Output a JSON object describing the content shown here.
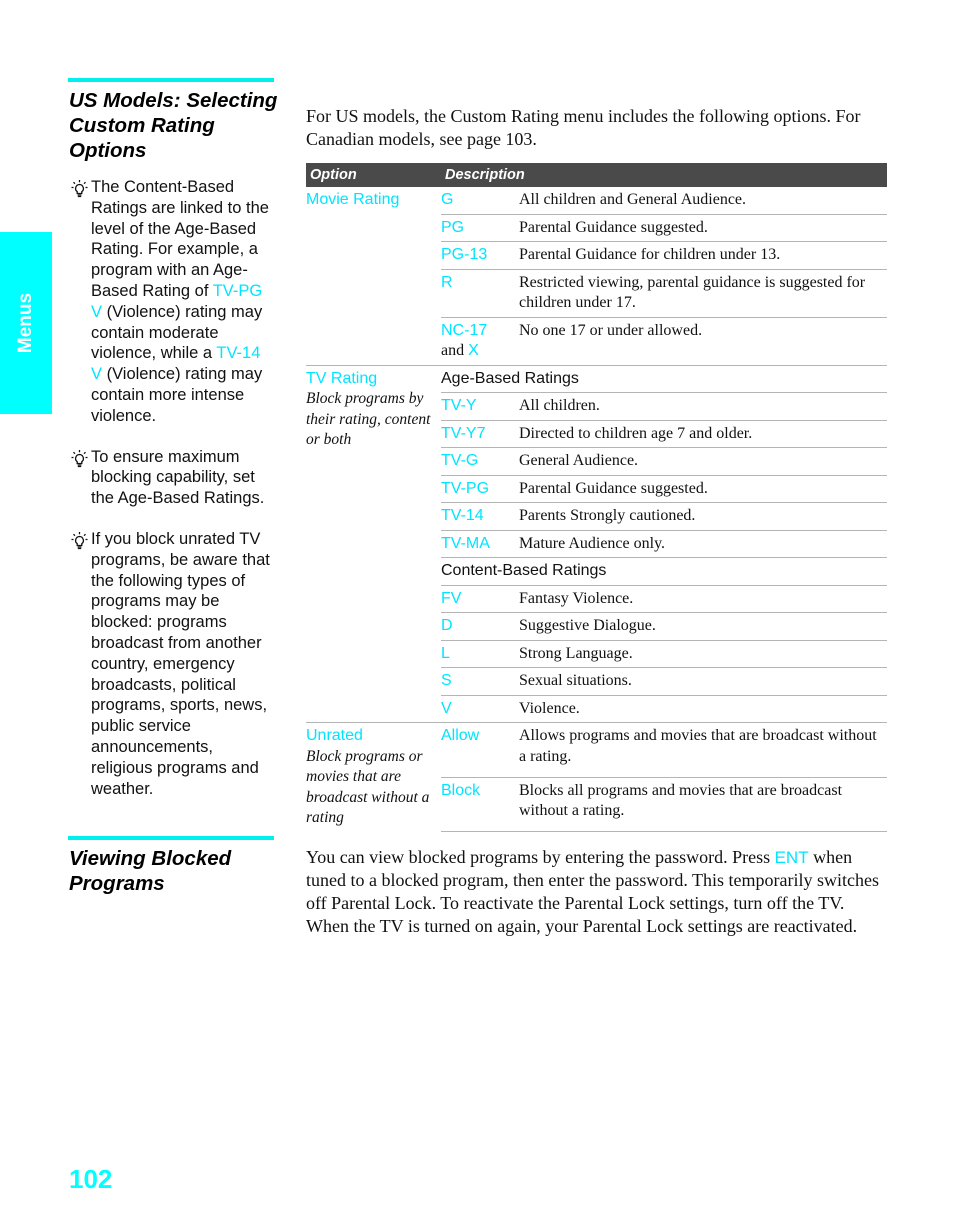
{
  "side_tab": {
    "label": "Menus"
  },
  "section1": {
    "heading": "US Models: Selecting Custom Rating Options",
    "intro": "For US models, the Custom Rating menu includes the following options. For Canadian models, see page 103.",
    "notes": [
      {
        "icon": "lightbulb-tip-icon",
        "parts": [
          {
            "text": "The Content-Based Ratings are linked to the level of the Age-Based Rating. For example, a program with an Age-Based Rating of ",
            "hl": false
          },
          {
            "text": "TV-PG V",
            "hl": true
          },
          {
            "text": " (Violence) rating may contain moderate violence, while a ",
            "hl": false
          },
          {
            "text": "TV-14 V",
            "hl": true
          },
          {
            "text": " (Violence) rating may contain more intense violence.",
            "hl": false
          }
        ]
      },
      {
        "icon": "lightbulb-tip-icon",
        "parts": [
          {
            "text": "To ensure maximum blocking capability, set the Age-Based Ratings.",
            "hl": false
          }
        ]
      },
      {
        "icon": "lightbulb-tip-icon",
        "parts": [
          {
            "text": "If you block unrated TV programs, be aware that the following types of programs may be blocked: programs broadcast from another country, emergency broadcasts, political programs, sports, news, public service announcements, religious programs and weather.",
            "hl": false
          }
        ]
      }
    ],
    "table": {
      "headers": [
        "Option",
        "Description"
      ],
      "groups": [
        {
          "option": "Movie Rating",
          "option_desc": "",
          "rows": [
            {
              "type": "item",
              "code": "G",
              "desc": "All children and General Audience."
            },
            {
              "type": "item",
              "code": "PG",
              "desc": "Parental Guidance suggested."
            },
            {
              "type": "item",
              "code": "PG-13",
              "desc": "Parental Guidance for children under 13."
            },
            {
              "type": "item",
              "code": "R",
              "desc": "Restricted viewing, parental guidance is suggested for children under 17."
            },
            {
              "type": "item",
              "code": "NC-17",
              "code_suffix_plain": "and ",
              "code_suffix_hl": "X",
              "desc": "No one 17 or under allowed."
            }
          ]
        },
        {
          "option": "TV Rating",
          "option_desc": "Block programs by their rating, content or both",
          "rows": [
            {
              "type": "sub",
              "label": "Age-Based Ratings"
            },
            {
              "type": "item",
              "code": "TV-Y",
              "desc": "All children."
            },
            {
              "type": "item",
              "code": "TV-Y7",
              "desc": "Directed to children age 7 and older."
            },
            {
              "type": "item",
              "code": "TV-G",
              "desc": "General Audience."
            },
            {
              "type": "item",
              "code": "TV-PG",
              "desc": "Parental Guidance suggested."
            },
            {
              "type": "item",
              "code": "TV-14",
              "desc": "Parents Strongly cautioned."
            },
            {
              "type": "item",
              "code": "TV-MA",
              "desc": "Mature Audience only."
            },
            {
              "type": "sub",
              "label": "Content-Based Ratings"
            },
            {
              "type": "item",
              "code": "FV",
              "desc": "Fantasy Violence."
            },
            {
              "type": "item",
              "code": "D",
              "desc": "Suggestive Dialogue."
            },
            {
              "type": "item",
              "code": "L",
              "desc": "Strong Language."
            },
            {
              "type": "item",
              "code": "S",
              "desc": "Sexual situations."
            },
            {
              "type": "item",
              "code": "V",
              "desc": "Violence."
            }
          ]
        },
        {
          "option": "Unrated",
          "option_desc": "Block programs or movies that are broadcast without a rating",
          "rows": [
            {
              "type": "item",
              "code": "Allow",
              "desc": "Allows programs and movies that are broadcast without a rating."
            },
            {
              "type": "item",
              "code": "Block",
              "desc": "Blocks all programs and movies that are broadcast without a rating."
            }
          ]
        }
      ]
    }
  },
  "section2": {
    "heading": "Viewing Blocked Programs",
    "body_before": "You can view blocked programs by entering the password. Press ",
    "body_key": "ENT",
    "body_after": " when tuned to a blocked program, then enter the password. This temporarily switches off Parental Lock. To reactivate the Parental Lock settings, turn off the TV. When the TV is turned on again, your Parental Lock settings are reactivated."
  },
  "page_number": "102",
  "colors": {
    "accent": "#00ffff",
    "header_bg": "#4a4a4a",
    "divider": "#b5b5b5"
  }
}
